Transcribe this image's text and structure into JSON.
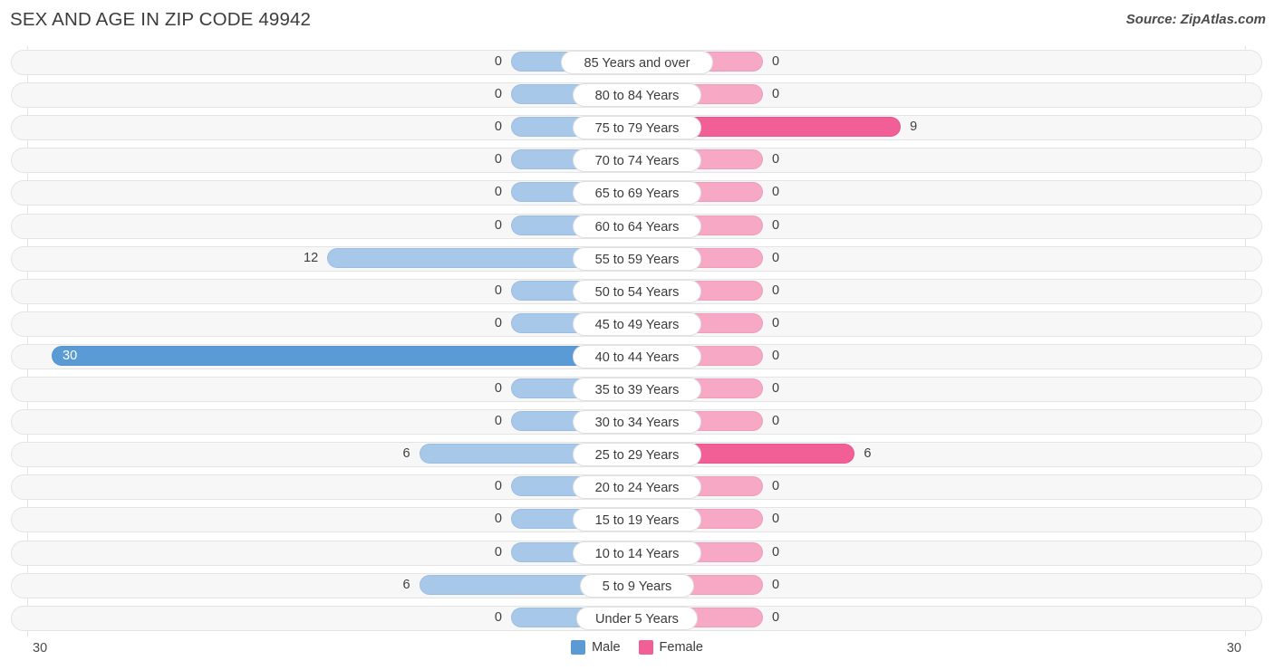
{
  "header": {
    "title": "SEX AND AGE IN ZIP CODE 49942",
    "source": "Source: ZipAtlas.com"
  },
  "legend": {
    "male_label": "Male",
    "female_label": "Female",
    "male_color": "#5b9bd5",
    "female_color": "#f15f96"
  },
  "axis": {
    "left_tick": "30",
    "right_tick": "30",
    "max": 30
  },
  "chart_data": {
    "type": "bar",
    "subtype": "population-pyramid",
    "title": "SEX AND AGE IN ZIP CODE 49942",
    "xlabel": "",
    "ylabel": "",
    "xlim": [
      30,
      30
    ],
    "grid": false,
    "legend_position": "bottom-center",
    "categories": [
      "85 Years and over",
      "80 to 84 Years",
      "75 to 79 Years",
      "70 to 74 Years",
      "65 to 69 Years",
      "60 to 64 Years",
      "55 to 59 Years",
      "50 to 54 Years",
      "45 to 49 Years",
      "40 to 44 Years",
      "35 to 39 Years",
      "30 to 34 Years",
      "25 to 29 Years",
      "20 to 24 Years",
      "15 to 19 Years",
      "10 to 14 Years",
      "5 to 9 Years",
      "Under 5 Years"
    ],
    "series": [
      {
        "name": "Male",
        "color": "#5b9bd5",
        "values": [
          0,
          0,
          0,
          0,
          0,
          0,
          12,
          0,
          0,
          30,
          0,
          0,
          6,
          0,
          0,
          0,
          6,
          0
        ]
      },
      {
        "name": "Female",
        "color": "#f15f96",
        "values": [
          0,
          0,
          9,
          0,
          0,
          0,
          0,
          0,
          0,
          0,
          0,
          0,
          6,
          0,
          0,
          0,
          0,
          0
        ]
      }
    ]
  }
}
